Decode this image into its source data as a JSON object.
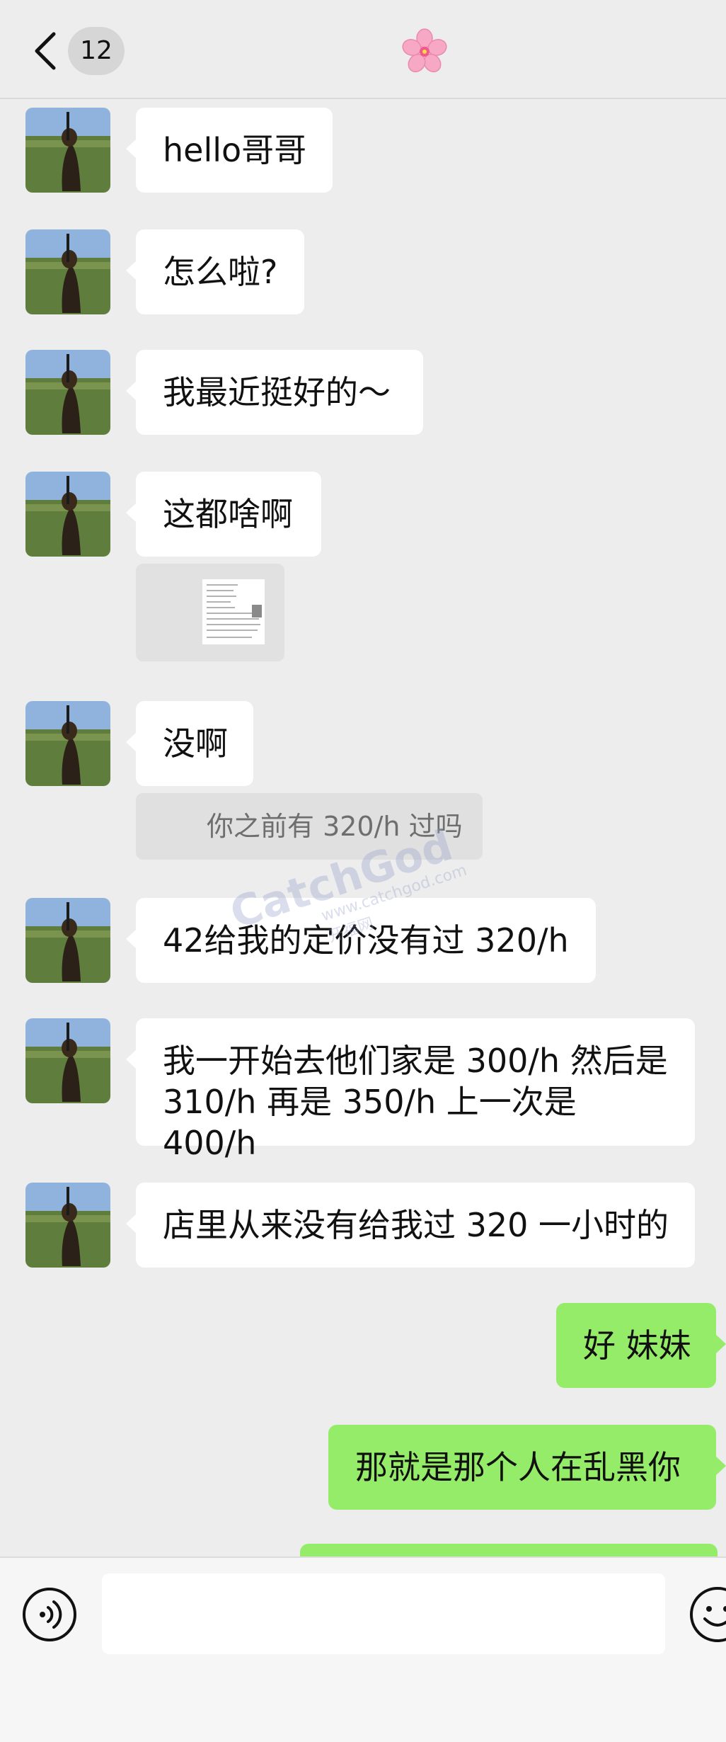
{
  "header": {
    "unread_count": "12",
    "title": "🌸"
  },
  "messages": [
    {
      "side": "left",
      "text": "hello哥哥"
    },
    {
      "side": "left",
      "text": "怎么啦?"
    },
    {
      "side": "left",
      "text": "我最近挺好的～"
    },
    {
      "side": "left",
      "text": "这都啥啊"
    },
    {
      "side": "left",
      "text": "没啊",
      "quote": "你之前有 320/h 过吗"
    },
    {
      "side": "left",
      "text": "42给我的定价没有过 320/h"
    },
    {
      "side": "left",
      "text": "我一开始去他们家是 300/h 然后是 310/h 再是 350/h 上一次是 400/h"
    },
    {
      "side": "left",
      "text": "店里从来没有给我过 320 一小时的"
    },
    {
      "side": "right",
      "text": "好 妹妹"
    },
    {
      "side": "right",
      "text": "那就是那个人在乱黑你"
    }
  ],
  "watermark": {
    "text": "CatchGod",
    "sub": "www.catchgod.com 开福网"
  },
  "input": {
    "value": ""
  },
  "colors": {
    "background": "#ededed",
    "incoming_bubble": "#ffffff",
    "outgoing_bubble": "#95ec69"
  }
}
